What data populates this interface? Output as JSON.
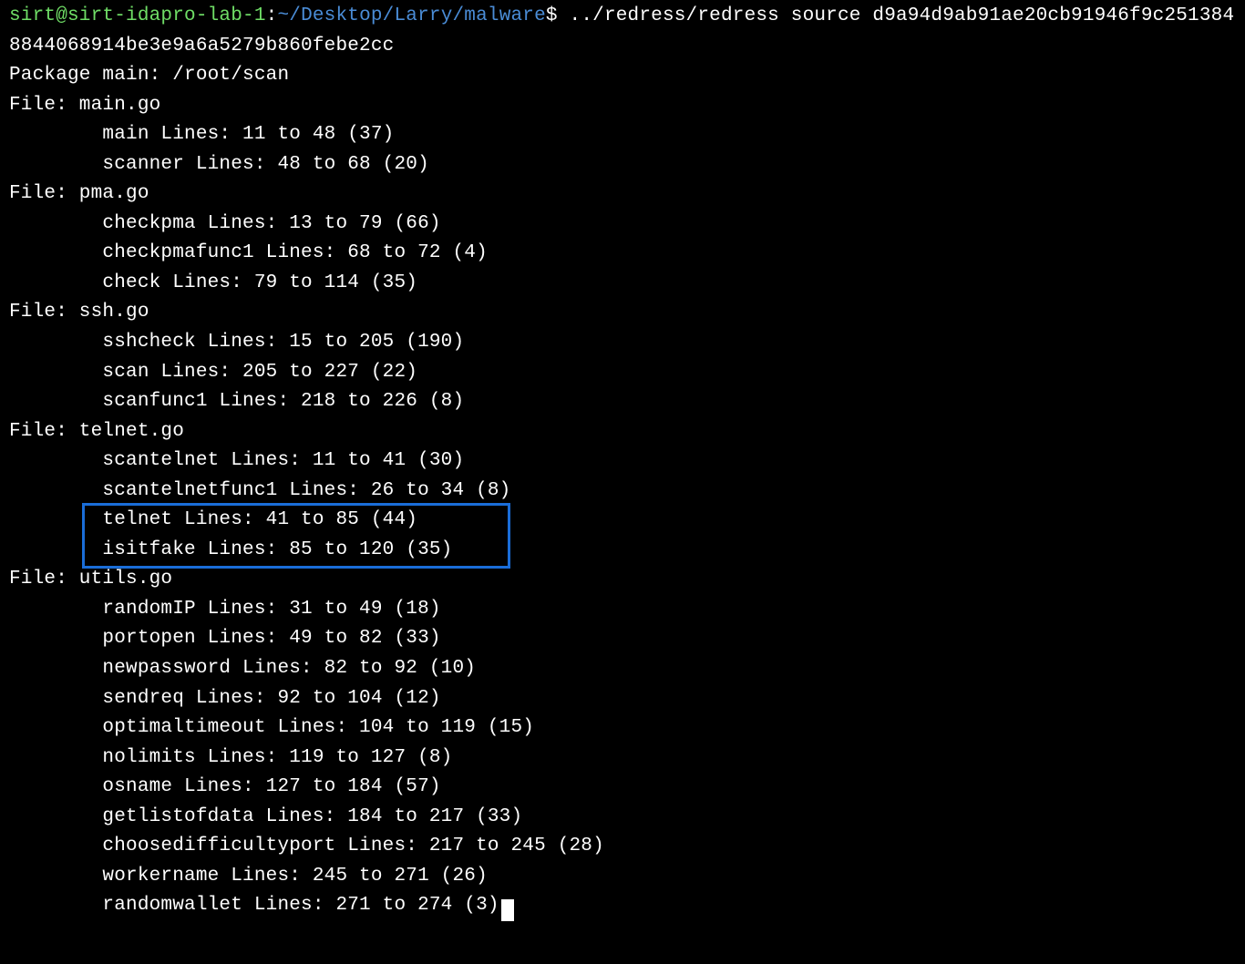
{
  "prompt": {
    "userhost": "sirt@sirt-idapro-lab-1",
    "colon": ":",
    "path": "~/Desktop/Larry/malware",
    "dollar": "$",
    "command": " ../redress/redress source d9a94d9ab91ae20cb91946f9c2513848844068914be3e9a6a5279b860febe2cc"
  },
  "output": {
    "package_line": "Package main: /root/scan",
    "files": [
      {
        "header": "File: main.go",
        "functions": [
          "        main Lines: 11 to 48 (37)",
          "        scanner Lines: 48 to 68 (20)"
        ]
      },
      {
        "header": "File: pma.go",
        "functions": [
          "        checkpma Lines: 13 to 79 (66)",
          "        checkpmafunc1 Lines: 68 to 72 (4)",
          "        check Lines: 79 to 114 (35)"
        ]
      },
      {
        "header": "File: ssh.go",
        "functions": [
          "        sshcheck Lines: 15 to 205 (190)",
          "        scan Lines: 205 to 227 (22)",
          "        scanfunc1 Lines: 218 to 226 (8)"
        ]
      },
      {
        "header": "File: telnet.go",
        "functions": [
          "        scantelnet Lines: 11 to 41 (30)",
          "        scantelnetfunc1 Lines: 26 to 34 (8)"
        ],
        "highlighted": [
          "        telnet Lines: 41 to 85 (44)",
          "        isitfake Lines: 85 to 120 (35)"
        ]
      },
      {
        "header": "File: utils.go",
        "functions": [
          "        randomIP Lines: 31 to 49 (18)",
          "        portopen Lines: 49 to 82 (33)",
          "        newpassword Lines: 82 to 92 (10)",
          "        sendreq Lines: 92 to 104 (12)",
          "        optimaltimeout Lines: 104 to 119 (15)",
          "        nolimits Lines: 119 to 127 (8)",
          "        osname Lines: 127 to 184 (57)",
          "        getlistofdata Lines: 184 to 217 (33)",
          "        choosedifficultyport Lines: 217 to 245 (28)",
          "        workername Lines: 245 to 271 (26)",
          "        randomwallet Lines: 271 to 274 (3)"
        ]
      }
    ]
  }
}
